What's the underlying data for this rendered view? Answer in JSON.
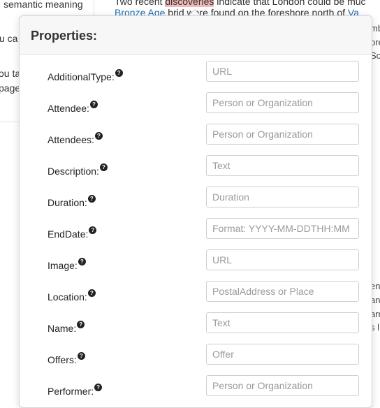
{
  "background": {
    "sidebar_lines": [
      "semantic meaning",
      "u ca",
      "ou ta",
      "page,"
    ],
    "article_line1_pre": "Two recent ",
    "article_line1_hl": "discoveries",
    "article_line1_post": " indicate that London could be muc",
    "article_line2_link": "Bronze Age",
    "article_line2_mid": " brid",
    "article_line2_post": " were found on the foreshore north of ",
    "article_line2_link2": "Va",
    "right_fragments_top": [
      "mb",
      "ore",
      "So"
    ],
    "right_fragments_bottom": [
      "en",
      "an",
      "arr",
      "s l"
    ]
  },
  "popup": {
    "title": "Properties:",
    "help_glyph": "?",
    "properties": [
      {
        "label": "AdditionalType:",
        "placeholder": "URL"
      },
      {
        "label": "Attendee:",
        "placeholder": "Person or Organization"
      },
      {
        "label": "Attendees:",
        "placeholder": "Person or Organization"
      },
      {
        "label": "Description:",
        "placeholder": "Text"
      },
      {
        "label": "Duration:",
        "placeholder": "Duration"
      },
      {
        "label": "EndDate:",
        "placeholder": "Format: YYYY-MM-DDTHH:MM"
      },
      {
        "label": "Image:",
        "placeholder": "URL"
      },
      {
        "label": "Location:",
        "placeholder": "PostalAddress or Place"
      },
      {
        "label": "Name:",
        "placeholder": "Text"
      },
      {
        "label": "Offers:",
        "placeholder": "Offer"
      },
      {
        "label": "Performer:",
        "placeholder": "Person or Organization"
      }
    ]
  }
}
